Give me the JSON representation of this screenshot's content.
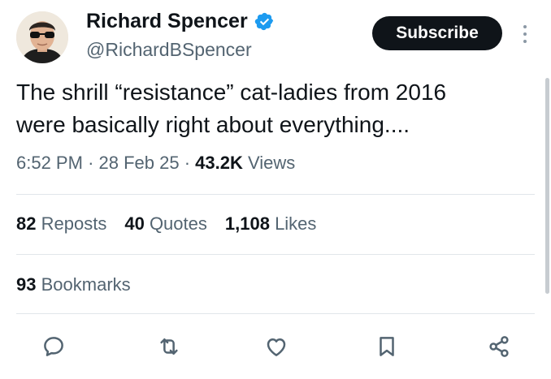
{
  "author": {
    "display_name": "Richard Spencer",
    "handle": "@RichardBSpencer",
    "verified_icon": "verified-badge-icon",
    "avatar_icon": "profile-avatar"
  },
  "header": {
    "subscribe_label": "Subscribe",
    "more_icon": "more-vertical-icon"
  },
  "tweet": {
    "text": "The shrill “resistance” cat-ladies from 2016\nwere basically right about everything....",
    "time": "6:52 PM",
    "date": "28 Feb 25",
    "separator": "·",
    "views_count": "43.2K",
    "views_label": "Views"
  },
  "stats": {
    "reposts_count": "82",
    "reposts_label": "Reposts",
    "quotes_count": "40",
    "quotes_label": "Quotes",
    "likes_count": "1,108",
    "likes_label": "Likes",
    "bookmarks_count": "93",
    "bookmarks_label": "Bookmarks"
  },
  "actions": [
    {
      "icon": "reply-icon"
    },
    {
      "icon": "repost-icon"
    },
    {
      "icon": "like-icon"
    },
    {
      "icon": "bookmark-icon"
    },
    {
      "icon": "share-icon"
    }
  ],
  "colors": {
    "text_primary": "#0f1419",
    "text_secondary": "#536471",
    "verified_blue": "#1d9bf0",
    "divider": "#e1e6ea",
    "subscribe_bg": "#0f1419"
  }
}
